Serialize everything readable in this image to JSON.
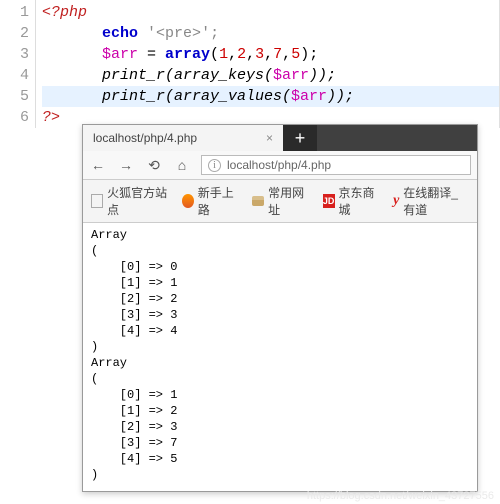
{
  "editor": {
    "line_numbers": [
      "1",
      "2",
      "3",
      "4",
      "5",
      "6"
    ],
    "line1": {
      "open_tag": "<?php"
    },
    "line2": {
      "echo": "echo",
      "str_open": "'",
      "str_body": "<pre>",
      "str_close": "';"
    },
    "line3": {
      "var": "$arr",
      "eq": " = ",
      "func": "array",
      "open": "(",
      "n1": "1",
      "c": ",",
      "n2": "2",
      "n3": "3",
      "n4": "7",
      "n5": "5",
      "close": ");"
    },
    "line4": {
      "call": "print_r(array_keys(",
      "var": "$arr",
      "tail": "));"
    },
    "line5": {
      "call": "print_r(array_values(",
      "var": "$arr",
      "tail": "));"
    },
    "line6": {
      "close_tag": "?>"
    }
  },
  "browser": {
    "tab_title": "localhost/php/4.php",
    "new_tab": "+",
    "url": "localhost/php/4.php",
    "bookmarks": {
      "b1": "火狐官方站点",
      "b2": "新手上路",
      "b3": "常用网址",
      "b4_badge": "JD",
      "b4": "京东商城",
      "b5_badge": "y",
      "b5": "在线翻译_有道"
    },
    "output": "Array\n(\n    [0] => 0\n    [1] => 1\n    [2] => 2\n    [3] => 3\n    [4] => 4\n)\nArray\n(\n    [0] => 1\n    [1] => 2\n    [2] => 3\n    [3] => 7\n    [4] => 5\n)"
  },
  "watermark": "https://blog.csdn.net/weixin_43727556"
}
